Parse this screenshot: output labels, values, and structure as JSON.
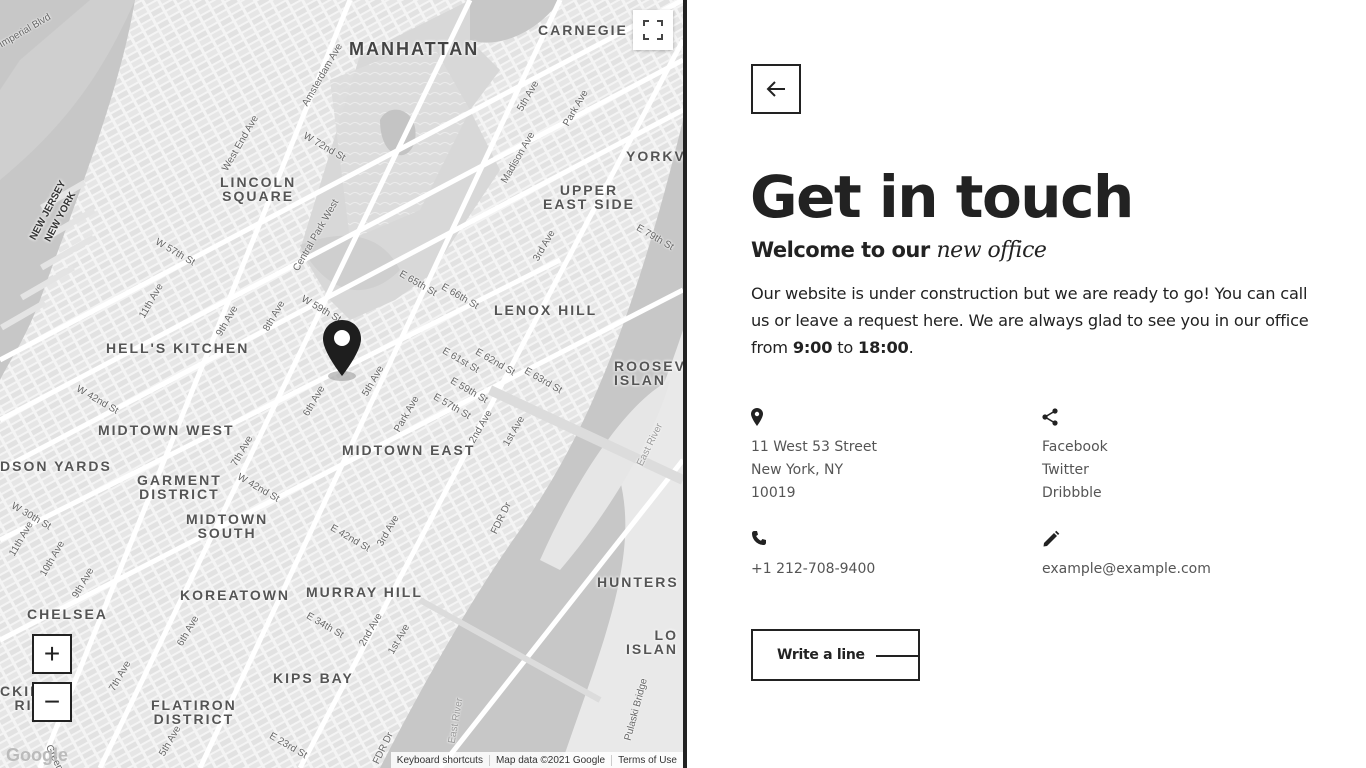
{
  "map": {
    "neighborhoods": [
      {
        "id": "manhattan",
        "text": "MANHATTAN"
      },
      {
        "id": "carnegie",
        "text": "CARNEGIE"
      },
      {
        "id": "lincoln-square",
        "text": "LINCOLN\nSQUARE"
      },
      {
        "id": "upper-east-side",
        "text": "UPPER\nEAST SIDE"
      },
      {
        "id": "yorkville",
        "text": "YORKV"
      },
      {
        "id": "lenox-hill",
        "text": "LENOX HILL"
      },
      {
        "id": "hells-kitchen",
        "text": "HELL'S KITCHEN"
      },
      {
        "id": "roosevelt-island",
        "text": "ROOSEV\nISLAN"
      },
      {
        "id": "midtown-west",
        "text": "MIDTOWN WEST"
      },
      {
        "id": "midtown-east",
        "text": "MIDTOWN EAST"
      },
      {
        "id": "hudson-yards",
        "text": "DSON YARDS"
      },
      {
        "id": "garment-district",
        "text": "GARMENT\nDISTRICT"
      },
      {
        "id": "midtown-south",
        "text": "MIDTOWN\nSOUTH"
      },
      {
        "id": "koreatown",
        "text": "KOREATOWN"
      },
      {
        "id": "murray-hill",
        "text": "MURRAY HILL"
      },
      {
        "id": "hunters",
        "text": "HUNTERS"
      },
      {
        "id": "chelsea",
        "text": "CHELSEA"
      },
      {
        "id": "long-island",
        "text": "LO\nISLAN"
      },
      {
        "id": "kips-bay",
        "text": "KIPS BAY"
      },
      {
        "id": "flatiron-district",
        "text": "FLATIRON\nDISTRICT"
      },
      {
        "id": "packing-district",
        "text": "CKING\nRICT"
      },
      {
        "id": "new-jersey",
        "text": "NEW JERSEY\nNEW YORK"
      }
    ],
    "streets": [
      "Imperial Blvd",
      "Amsterdam Ave",
      "W 72nd St",
      "West End Ave",
      "Central Park West",
      "5th Ave",
      "Park Ave",
      "Madison Ave",
      "E 79th St",
      "3rd Ave",
      "E 65th St",
      "E 66th St",
      "W 57th St",
      "11th Ave",
      "9th Ave",
      "8th Ave",
      "W 59th St",
      "5th Ave",
      "Park Ave",
      "E 61st St",
      "E 62nd St",
      "E 63rd St",
      "E 59th St",
      "E 57th St",
      "2nd Ave",
      "1st Ave",
      "W 42nd St",
      "6th Ave",
      "7th Ave",
      "W 42nd St",
      "E 42nd St",
      "3rd Ave",
      "FDR Dr",
      "W 30th St",
      "11th Ave",
      "10th Ave",
      "9th Ave",
      "6th Ave",
      "E 34th St",
      "2nd Ave",
      "1st Ave",
      "7th Ave",
      "5th Ave",
      "E 23rd St",
      "FDR Dr",
      "East River",
      "East River",
      "Pulaski Bridge",
      "Greenwich",
      "5th Ave"
    ],
    "footer": {
      "shortcuts": "Keyboard shortcuts",
      "map_data": "Map data ©2021 Google",
      "terms": "Terms of Use"
    },
    "logo_text": "Google",
    "controls": {
      "zoom_in": "+",
      "zoom_out": "−"
    }
  },
  "page": {
    "title": "Get in touch",
    "subtitle": {
      "main": "Welcome to our ",
      "accent": "new office"
    },
    "intro": {
      "text": "Our website is under construction but we are ready to go! You can call us or leave a request here. We are always glad to see you in our office from ",
      "open": "9:00",
      "between": " to ",
      "close": "18:00",
      "end": "."
    },
    "address": {
      "icon": "map-pin-icon",
      "lines": [
        "11 West 53 Street",
        "New York, NY",
        "10019"
      ]
    },
    "social": {
      "icon": "share-icon",
      "links": [
        "Facebook",
        "Twitter",
        "Dribbble"
      ]
    },
    "phone": {
      "icon": "phone-icon",
      "value": "+1 212-708-9400"
    },
    "email": {
      "icon": "pencil-icon",
      "value": "example@example.com"
    },
    "cta_label": "Write a line"
  },
  "colors": {
    "ink": "#222222",
    "muted": "#555555",
    "water": "#c8c8c8",
    "land": "#f3f3f3"
  }
}
